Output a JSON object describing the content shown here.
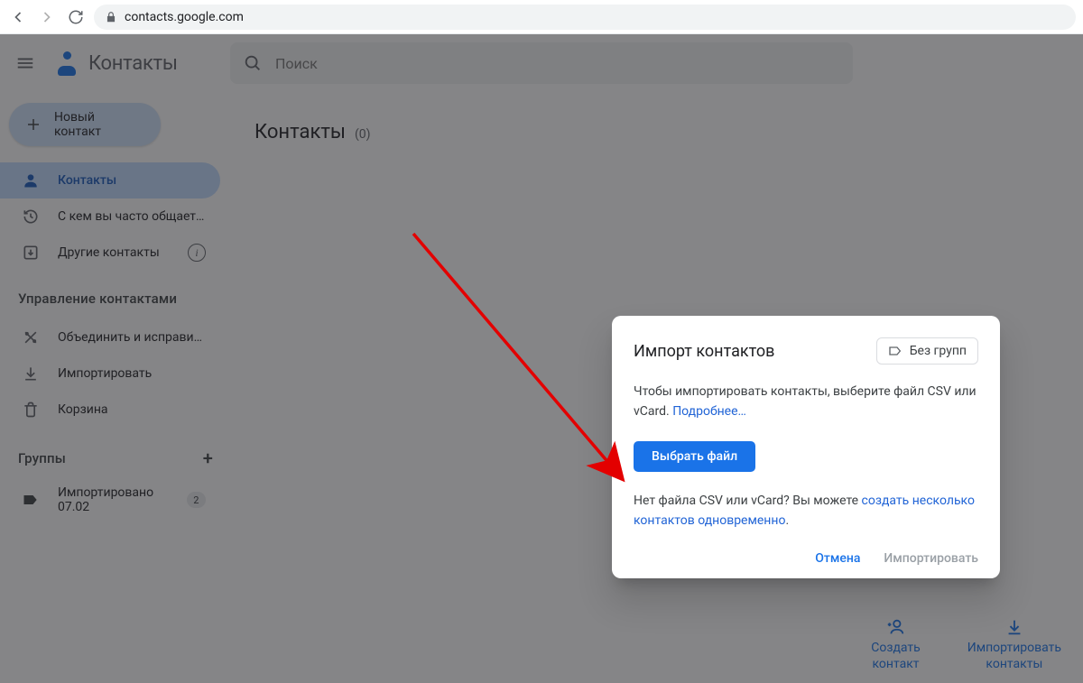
{
  "browser": {
    "url": "contacts.google.com"
  },
  "app": {
    "title": "Контакты",
    "search_placeholder": "Поиск"
  },
  "sidebar": {
    "new_button": "Новый контакт",
    "items": [
      {
        "label": "Контакты"
      },
      {
        "label": "С кем вы часто общает…"
      },
      {
        "label": "Другие контакты"
      }
    ],
    "manage_header": "Управление контактами",
    "manage": [
      {
        "label": "Объединить и исправить"
      },
      {
        "label": "Импортировать"
      },
      {
        "label": "Корзина"
      }
    ],
    "groups_header": "Группы",
    "groups": [
      {
        "label": "Импортировано 07.02",
        "count": "2"
      }
    ]
  },
  "main": {
    "heading": "Контакты",
    "count": "(0)"
  },
  "bottom": {
    "create": {
      "line1": "Создать",
      "line2": "контакт"
    },
    "import": {
      "line1": "Импортировать",
      "line2": "контакты"
    }
  },
  "dialog": {
    "title": "Импорт контактов",
    "chip": "Без групп",
    "body1": "Чтобы импортировать контакты, выберите файл CSV или vCard. ",
    "learn_more": "Подробнее…",
    "select_file": "Выбрать файл",
    "body2_pre": "Нет файла CSV или vCard? Вы можете ",
    "body2_link": "создать несколько контактов одновременно",
    "body2_post": ".",
    "cancel": "Отмена",
    "import": "Импортировать"
  }
}
